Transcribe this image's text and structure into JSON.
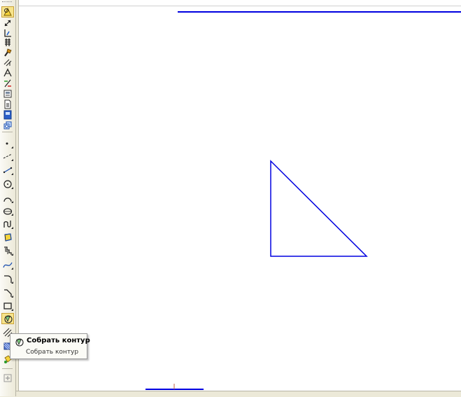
{
  "tooltip": {
    "title": "Собрать контур",
    "description": "Собрать контур"
  },
  "colors": {
    "drawing_line": "#0000e0",
    "toolbar_bg": "#ece9d8",
    "highlight": "#f7e48a"
  },
  "toolbar": {
    "buttons": [
      {
        "icon": "geometry-panel-icon",
        "active": true
      },
      {
        "icon": "dimensions-icon"
      },
      {
        "icon": "notation-icon"
      },
      {
        "icon": "editing-icon"
      },
      {
        "icon": "parametrization-icon"
      },
      {
        "icon": "measurements-icon"
      },
      {
        "icon": "selection-icon"
      },
      {
        "icon": "associative-views-icon"
      },
      {
        "icon": "specification-icon"
      },
      {
        "icon": "report-icon"
      },
      {
        "icon": "insert-fragment-icon"
      },
      {
        "icon": "spc-objects-icon"
      },
      {
        "icon": "views-icon"
      },
      {
        "icon": "point-tool-icon"
      },
      {
        "icon": "auxiliary-line-icon"
      },
      {
        "icon": "segment-tool-icon"
      },
      {
        "icon": "circle-tool-icon"
      },
      {
        "icon": "arc-tool-icon"
      },
      {
        "icon": "ellipse-tool-icon"
      },
      {
        "icon": "continuous-input-icon"
      },
      {
        "icon": "polyline-tool-icon"
      },
      {
        "icon": "curve-tool-icon"
      },
      {
        "icon": "bezier-curve-icon"
      },
      {
        "icon": "fillet-tool-icon"
      },
      {
        "icon": "chamfer-tool-icon"
      },
      {
        "icon": "rectangle-tool-icon"
      },
      {
        "icon": "collect-contour-icon",
        "active": true
      },
      {
        "icon": "hatching-icon"
      },
      {
        "icon": "equidistant-icon"
      },
      {
        "icon": "fill-tool-icon"
      },
      {
        "icon": "add-object-icon"
      }
    ]
  }
}
